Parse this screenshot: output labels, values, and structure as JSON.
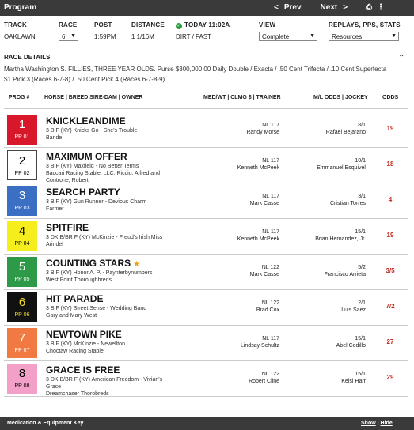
{
  "topbar": {
    "title": "Program",
    "prev_icon": "<",
    "prev_label": "Prev",
    "next_label": "Next",
    "next_icon": ">",
    "print_icon": "printer-icon",
    "print_glyph": "⎙",
    "more_glyph": "⋮"
  },
  "meta": {
    "track_label": "TRACK",
    "track_value": "OAKLAWN",
    "race_label": "RACE",
    "race_value": "6",
    "post_label": "POST",
    "post_value": "1:59PM",
    "distance_label": "DISTANCE",
    "distance_value": "1 1/16M",
    "today_label": "TODAY 11:02A",
    "surface_value": "DIRT / FAST",
    "view_label": "VIEW",
    "view_value": "Complete",
    "replays_label": "REPLAYS, PPS, STATS",
    "replays_value": "Resources"
  },
  "race_details": {
    "title": "RACE DETAILS",
    "text": "Martha Washington S. FILLIES, THREE YEAR OLDS. Purse $300,000.00 Daily Double / Exacta / .50 Cent Trifecta / .10 Cent Superfecta $1 Pick 3 (Races 6-7-8) / .50 Cent Pick 4 (Races 6-7-8-9)"
  },
  "columns": {
    "prog": "PROG #",
    "horse": "HORSE | BREED SIRE-DAM | OWNER",
    "medwt": "MED/WT | CLMG $ | TRAINER",
    "ml": "M/L ODDS | JOCKEY",
    "odds": "ODDS"
  },
  "entries": [
    {
      "num": "1",
      "pp": "PP 01",
      "bg": "#d8182a",
      "fg": "#ffffff",
      "name": "KNICKLEANDIME",
      "star": "",
      "l1": "3 B F (KY) Knicks Go - She's Trouble",
      "l2": "Bande",
      "l3": "",
      "medwt": "NL 117",
      "trainer": "Randy Morse",
      "ml": "8/1",
      "jockey": "Rafael Bejarano",
      "odds": "19"
    },
    {
      "num": "2",
      "pp": "PP 02",
      "bg": "#ffffff",
      "fg": "#000000",
      "name": "MAXIMUM OFFER",
      "star": "",
      "l1": "3 B F (KY) Maxfield - No Better Terms",
      "l2": "Baccari Racing Stable, LLC, Riccio, Alfred and",
      "l3": "Controne, Robert",
      "medwt": "NL 117",
      "trainer": "Kenneth McPeek",
      "ml": "10/1",
      "jockey": "Emmanuel Esquivel",
      "odds": "18"
    },
    {
      "num": "3",
      "pp": "PP 03",
      "bg": "#3a6fc4",
      "fg": "#ffffff",
      "name": "SEARCH PARTY",
      "star": "",
      "l1": "3 B F (KY) Gun Runner - Devious Charm",
      "l2": "Farmer",
      "l3": "",
      "medwt": "NL 117",
      "trainer": "Mark Casse",
      "ml": "3/1",
      "jockey": "Cristian Torres",
      "odds": "4"
    },
    {
      "num": "4",
      "pp": "PP 04",
      "bg": "#f5ee1c",
      "fg": "#000000",
      "name": "SPITFIRE",
      "star": "",
      "l1": "3 DK B/BR F (KY) McKinzie - Freud's Irish Miss",
      "l2": "Arindel",
      "l3": "",
      "medwt": "NL 117",
      "trainer": "Kenneth McPeek",
      "ml": "15/1",
      "jockey": "Brian Hernandez, Jr.",
      "odds": "19"
    },
    {
      "num": "5",
      "pp": "PP 05",
      "bg": "#2e9a48",
      "fg": "#ffffff",
      "name": "COUNTING STARS",
      "star": "★",
      "l1": "3 B F (KY) Honor A. P. - Paynterbynumbers",
      "l2": "West Point Thoroughbreds",
      "l3": "",
      "medwt": "NL 122",
      "trainer": "Mark Casse",
      "ml": "5/2",
      "jockey": "Francisco Arrieta",
      "odds": "3/5"
    },
    {
      "num": "6",
      "pp": "PP 06",
      "bg": "#111111",
      "fg": "#f5dc2a",
      "name": "HIT PARADE",
      "star": "",
      "l1": "3 B F (KY) Street Sense - Wedding Band",
      "l2": "Gary and Mary West",
      "l3": "",
      "medwt": "NL 122",
      "trainer": "Brad Cox",
      "ml": "2/1",
      "jockey": "Luis Saez",
      "odds": "7/2"
    },
    {
      "num": "7",
      "pp": "PP 07",
      "bg": "#f07a42",
      "fg": "#ffffff",
      "name": "NEWTOWN PIKE",
      "star": "",
      "l1": "3 B F (KY) McKinzie - Newellton",
      "l2": "Choctaw Racing Stable",
      "l3": "",
      "medwt": "NL 117",
      "trainer": "Lindsay Schultz",
      "ml": "15/1",
      "jockey": "Abel Cedillo",
      "odds": "27"
    },
    {
      "num": "8",
      "pp": "PP 08",
      "bg": "#f2a0c8",
      "fg": "#000000",
      "name": "GRACE IS FREE",
      "star": "",
      "l1": "3 DK B/BR F (KY) American Freedom - Vivian's",
      "l2": "Grace",
      "l3": "Dreamchaser Thorobreds",
      "medwt": "NL 122",
      "trainer": "Robert Cline",
      "ml": "15/1",
      "jockey": "Kelsi Harr",
      "odds": "29"
    }
  ],
  "footer": {
    "label": "Medication & Equipment Key",
    "show": "Show",
    "sep": "|",
    "hide": "Hide"
  }
}
